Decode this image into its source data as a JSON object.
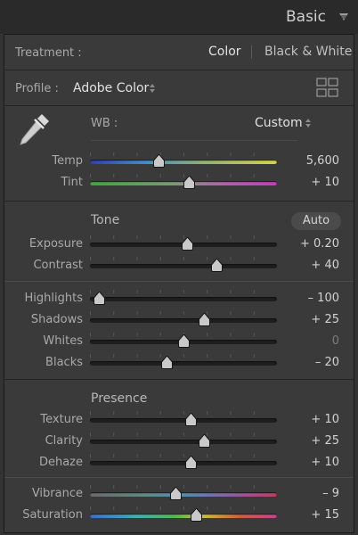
{
  "panel": {
    "title": "Basic"
  },
  "treatment": {
    "label": "Treatment :",
    "color": "Color",
    "bw": "Black & White"
  },
  "profile": {
    "label": "Profile :",
    "value": "Adobe Color"
  },
  "wb": {
    "label": "WB :",
    "value": "Custom"
  },
  "sliders": [
    {
      "id": "temp",
      "label": "Temp",
      "display": "5,600",
      "position": 0.37,
      "gradient": "linear-gradient(to right,#2f3fb4,#3f8fc8 30%,#90b070 60%,#d6d54a)"
    },
    {
      "id": "tint",
      "label": "Tint",
      "display": "+ 10",
      "position": 0.53,
      "gradient": "linear-gradient(to right,#3ca93c,#7b9a77 45%,#b064a8 70%,#c839c0)"
    },
    {
      "id": "exposure",
      "label": "Exposure",
      "display": "+ 0.20",
      "position": 0.52,
      "gradient": ""
    },
    {
      "id": "contrast",
      "label": "Contrast",
      "display": "+ 40",
      "position": 0.68,
      "gradient": ""
    },
    {
      "id": "highlights",
      "label": "Highlights",
      "display": "– 100",
      "position": 0.05,
      "gradient": ""
    },
    {
      "id": "shadows",
      "label": "Shadows",
      "display": "+ 25",
      "position": 0.61,
      "gradient": ""
    },
    {
      "id": "whites",
      "label": "Whites",
      "display": "0",
      "position": 0.5,
      "gradient": ""
    },
    {
      "id": "blacks",
      "label": "Blacks",
      "display": "– 20",
      "position": 0.41,
      "gradient": ""
    },
    {
      "id": "texture",
      "label": "Texture",
      "display": "+ 10",
      "position": 0.54,
      "gradient": ""
    },
    {
      "id": "clarity",
      "label": "Clarity",
      "display": "+ 25",
      "position": 0.61,
      "gradient": ""
    },
    {
      "id": "dehaze",
      "label": "Dehaze",
      "display": "+ 10",
      "position": 0.54,
      "gradient": ""
    },
    {
      "id": "vibrance",
      "label": "Vibrance",
      "display": "– 9",
      "position": 0.46,
      "gradient": "linear-gradient(to right,#6a6a6a,#5f8a82 30%,#4c8fb0 50%,#8a5ea8 75%,#c03c60)"
    },
    {
      "id": "saturation",
      "label": "Saturation",
      "display": "+ 15",
      "position": 0.57,
      "gradient": "linear-gradient(to right,#3a6ed0,#3fb0b0 25%,#54b452 45%,#c8c23a 60%,#cc5f3a 80%,#c84090)"
    }
  ],
  "tone": {
    "label": "Tone",
    "auto": "Auto"
  },
  "presence": {
    "label": "Presence"
  }
}
